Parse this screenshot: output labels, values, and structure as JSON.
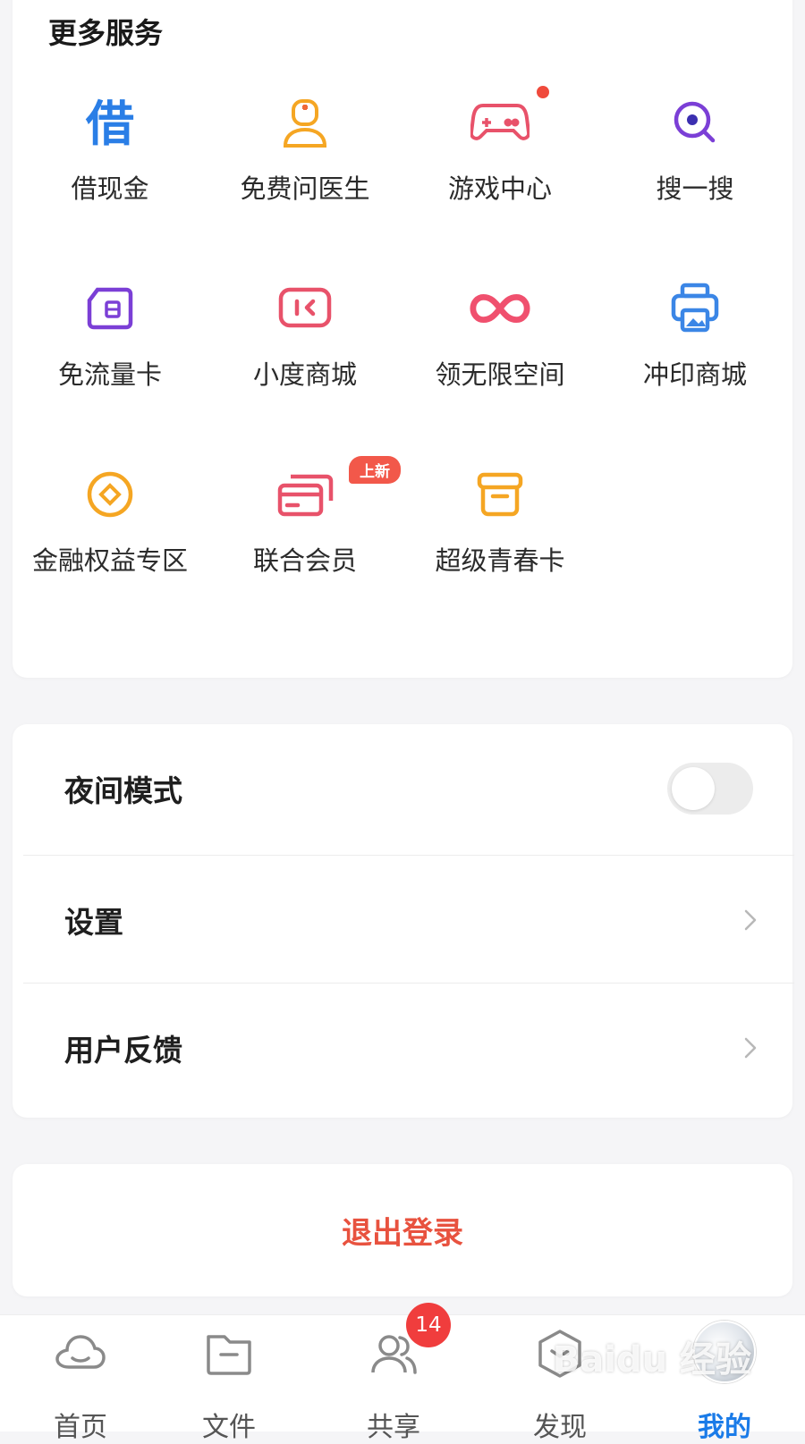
{
  "services": {
    "title": "更多服务",
    "items": [
      {
        "label": "借现金",
        "icon": "borrow-char-icon",
        "color": "#2a7ee6"
      },
      {
        "label": "免费问医生",
        "icon": "doctor-icon",
        "color": "#f5a623"
      },
      {
        "label": "游戏中心",
        "icon": "gamepad-icon",
        "color": "#e8526a",
        "dot": true
      },
      {
        "label": "搜一搜",
        "icon": "search-icon",
        "color": "#7b3fd6"
      },
      {
        "label": "免流量卡",
        "icon": "sim-card-icon",
        "color": "#7b3fd6"
      },
      {
        "label": "小度商城",
        "icon": "xiaodu-icon",
        "color": "#e8526a"
      },
      {
        "label": "领无限空间",
        "icon": "infinity-icon",
        "color": "#f0506e"
      },
      {
        "label": "冲印商城",
        "icon": "printer-icon",
        "color": "#3b86e6"
      },
      {
        "label": "金融权益专区",
        "icon": "coin-icon",
        "color": "#f5a623"
      },
      {
        "label": "联合会员",
        "icon": "cards-icon",
        "color": "#e8526a",
        "badge": "上新"
      },
      {
        "label": "超级青春卡",
        "icon": "box-icon",
        "color": "#f5a623"
      }
    ]
  },
  "settings": {
    "night_mode": "夜间模式",
    "settings": "设置",
    "feedback": "用户反馈"
  },
  "logout": "退出登录",
  "tabbar": {
    "home": "首页",
    "files": "文件",
    "share": "共享",
    "share_badge": "14",
    "discover": "发现",
    "mine": "我的"
  },
  "watermark": "Baidu 经验",
  "colors": {
    "accent": "#1a7be8",
    "logout": "#e8523f",
    "badge": "#f03d3d"
  }
}
